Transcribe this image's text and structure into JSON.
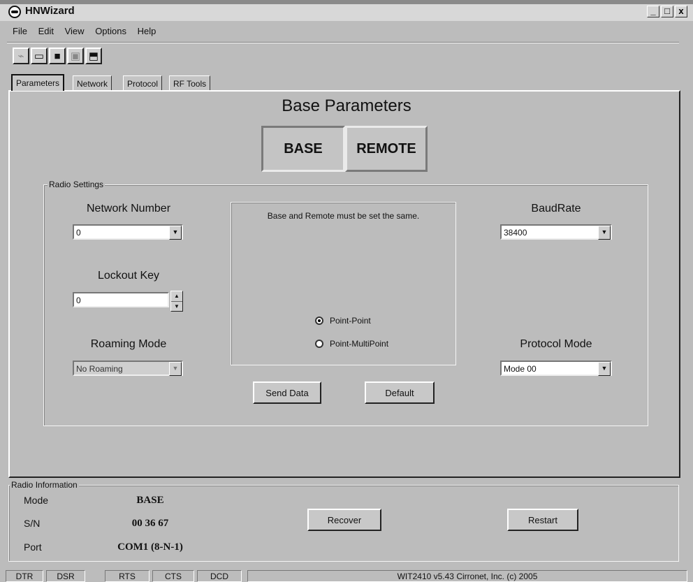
{
  "window": {
    "title": "HNWizard",
    "controls": {
      "minimize": "_",
      "maximize": "□",
      "close": "x"
    }
  },
  "menu": [
    "File",
    "Edit",
    "View",
    "Options",
    "Help"
  ],
  "toolbar": {
    "buttons": [
      {
        "name": "connect",
        "icon": "plug-icon",
        "glyph": "⌁",
        "enabled": false
      },
      {
        "name": "open",
        "icon": "folder-open-icon",
        "glyph": "▭",
        "enabled": true
      },
      {
        "name": "save",
        "icon": "floppy-disk-icon",
        "glyph": "■",
        "enabled": true
      },
      {
        "name": "save-disabled",
        "icon": "floppy-disk-icon",
        "glyph": "▣",
        "enabled": false
      },
      {
        "name": "load",
        "icon": "folder-arrow-icon",
        "glyph": "⬒",
        "enabled": true
      }
    ]
  },
  "tabs": [
    {
      "label": "Parameters",
      "active": true
    },
    {
      "label": "Network",
      "active": false
    },
    {
      "label": "Protocol",
      "active": false
    },
    {
      "label": "RF Tools",
      "active": false
    }
  ],
  "parameters": {
    "heading": "Base Parameters",
    "base_label": "BASE",
    "remote_label": "REMOTE",
    "selected_mode": "BASE",
    "radio_settings": {
      "group_label": "Radio Settings",
      "network_number": {
        "label": "Network Number",
        "value": "0"
      },
      "lockout_key": {
        "label": "Lockout Key",
        "value": "0"
      },
      "roaming_mode": {
        "label": "Roaming Mode",
        "value": "No Roaming",
        "enabled": false
      },
      "note": "Base and Remote must be set the same.",
      "topology_options": [
        {
          "label": "Point-Point",
          "selected": true
        },
        {
          "label": "Point-MultiPoint",
          "selected": false
        }
      ],
      "baudrate": {
        "label": "BaudRate",
        "value": "38400"
      },
      "protocol_mode": {
        "label": "Protocol Mode",
        "value": "Mode 00"
      },
      "send_label": "Send Data",
      "default_label": "Default"
    }
  },
  "radio_info": {
    "group_label": "Radio Information",
    "mode": {
      "label": "Mode",
      "value": "BASE"
    },
    "sn": {
      "label": "S/N",
      "value": "00 36 67"
    },
    "port": {
      "label": "Port",
      "value": "COM1 (8-N-1)"
    },
    "recover_label": "Recover",
    "restart_label": "Restart"
  },
  "status_bar": {
    "indicators": [
      "DTR",
      "DSR",
      "RTS",
      "CTS",
      "DCD"
    ],
    "message": "WIT2410 v5.43 Cirronet, Inc. (c) 2005"
  }
}
